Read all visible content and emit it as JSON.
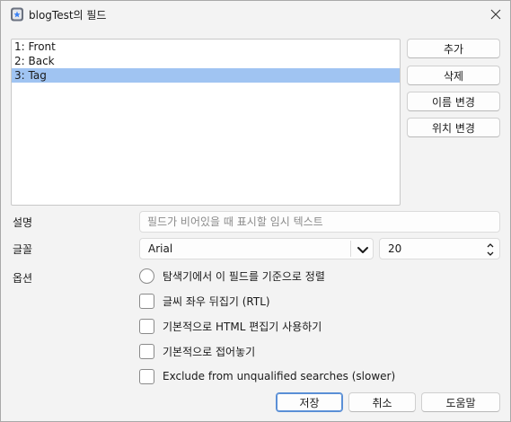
{
  "window": {
    "title": "blogTest의 필드",
    "icon": "anki-app-icon",
    "close_icon": "close-icon"
  },
  "fields": [
    "1: Front",
    "2: Back",
    "3: Tag"
  ],
  "selected_index": 2,
  "side_buttons": {
    "add": "추가",
    "delete": "삭제",
    "rename": "이름 변경",
    "reposition": "위치 변경"
  },
  "description": {
    "label": "설명",
    "value": "",
    "placeholder": "필드가 비어있을 때 표시할 임시 텍스트"
  },
  "font": {
    "label": "글꼴",
    "family": "Arial",
    "size": "20"
  },
  "options": {
    "label": "옵션",
    "items": [
      {
        "type": "radio",
        "label": "탐색기에서 이 필드를 기준으로 정렬",
        "checked": false
      },
      {
        "type": "checkbox",
        "label": "글씨 좌우 뒤집기 (RTL)",
        "checked": false
      },
      {
        "type": "checkbox",
        "label": "기본적으로 HTML 편집기 사용하기",
        "checked": false
      },
      {
        "type": "checkbox",
        "label": "기본적으로 접어놓기",
        "checked": false
      },
      {
        "type": "checkbox",
        "label": "Exclude from unqualified searches (slower)",
        "checked": false
      }
    ]
  },
  "footer": {
    "save": "저장",
    "cancel": "취소",
    "help": "도움말"
  },
  "colors": {
    "selection": "#a0c4f2",
    "primary_border": "#5a8fd6"
  }
}
